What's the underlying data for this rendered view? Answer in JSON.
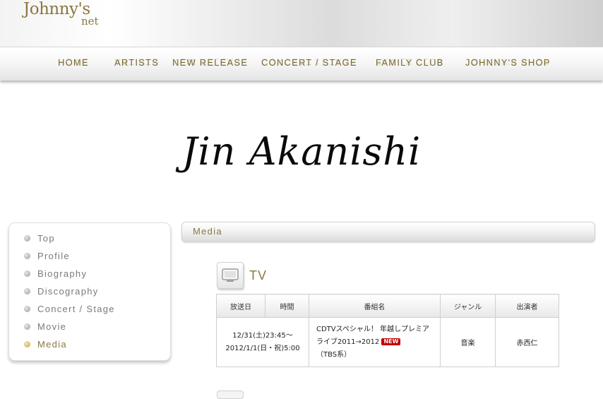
{
  "header": {
    "logo_line1": "Johnny's",
    "logo_line2": "net"
  },
  "nav": [
    "HOME",
    "ARTISTS",
    "NEW RELEASE",
    "CONCERT / STAGE",
    "FAMILY CLUB",
    "JOHNNY'S SHOP"
  ],
  "artist": {
    "name": "Jin Akanishi"
  },
  "sidebar": {
    "items": [
      {
        "label": "Top"
      },
      {
        "label": "Profile"
      },
      {
        "label": "Biography"
      },
      {
        "label": "Discography"
      },
      {
        "label": "Concert / Stage"
      },
      {
        "label": "Movie"
      },
      {
        "label": "Media"
      }
    ],
    "active": "Media"
  },
  "section": {
    "title": "Media"
  },
  "tv": {
    "heading": "TV",
    "columns": [
      "放送日",
      "時間",
      "番組名",
      "ジャンル",
      "出演者"
    ],
    "rows": [
      {
        "date_time_line1": "12/31(土)23:45～",
        "date_time_line2": "2012/1/1(日・祝)5:00",
        "program_line1": "CDTVスペシャル！ 年越しプレミア",
        "program_line2": "ライブ2011→2012",
        "badge": "NEW",
        "program_line3": "（TBS系）",
        "genre": "音楽",
        "cast": "赤西仁"
      }
    ]
  }
}
